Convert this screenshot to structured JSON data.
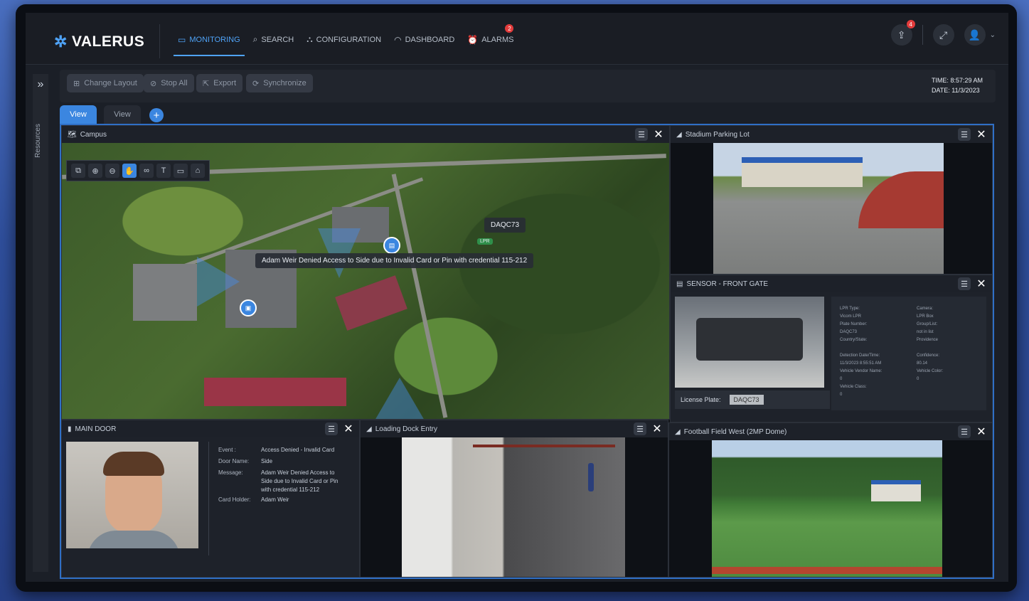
{
  "app": {
    "logo_text": "VALERUS"
  },
  "nav": [
    {
      "label": "MONITORING",
      "icon": "monitor-icon",
      "active": true
    },
    {
      "label": "SEARCH",
      "icon": "search-icon"
    },
    {
      "label": "CONFIGURATION",
      "icon": "network-icon"
    },
    {
      "label": "DASHBOARD",
      "icon": "gauge-icon"
    },
    {
      "label": "ALARMS",
      "icon": "alarm-icon",
      "badge": "2"
    }
  ],
  "topright": {
    "notify_badge": "4"
  },
  "rail": {
    "label": "Resources"
  },
  "toolbar": {
    "change_layout": "Change Layout",
    "stop_all": "Stop All",
    "export": "Export",
    "synchronize": "Synchronize",
    "time_label": "TIME:",
    "time_value": "8:57:29 AM",
    "date_label": "DATE:",
    "date_value": "11/3/2023"
  },
  "tabs": [
    "View",
    "View"
  ],
  "panes": {
    "campus": {
      "title": "Campus",
      "plate_label": "DAQC73",
      "lpr_tag": "LPR",
      "event_label": "Adam Weir Denied Access to Side due to Invalid Card or Pin with credential 115-212"
    },
    "stadium": {
      "title": "Stadium Parking Lot"
    },
    "sensor": {
      "title": "SENSOR - FRONT GATE",
      "license_label": "License Plate:",
      "plate_image_text": "DAQC73",
      "fields_left": [
        "LPR Type:",
        "Vicom LPR",
        "Plate Number:",
        "DAQC73",
        "Country/State:",
        "",
        "Detection Date/Time:",
        "11/3/2023 8:55:51 AM",
        "Vehicle Vendor Name:",
        "0",
        "Vehicle Class:",
        "0"
      ],
      "fields_right": [
        "Camera:",
        "LPR Box",
        "Group/List:",
        "not in list",
        "Providence",
        "",
        "Confidence:",
        "80.14",
        "Vehicle Color:",
        "0"
      ]
    },
    "door": {
      "title": "MAIN DOOR",
      "rows": [
        {
          "k": "Event :",
          "v": "Access Denied - Invalid Card"
        },
        {
          "k": "Door Name:",
          "v": "Side"
        },
        {
          "k": "Message:",
          "v": "Adam Weir Denied Access to Side due to Invalid Card or Pin with credential 115-212"
        },
        {
          "k": "Card Holder:",
          "v": "Adam Weir"
        }
      ]
    },
    "dock": {
      "title": "Loading Dock Entry"
    },
    "football": {
      "title": "Football Field West (2MP Dome)"
    }
  }
}
